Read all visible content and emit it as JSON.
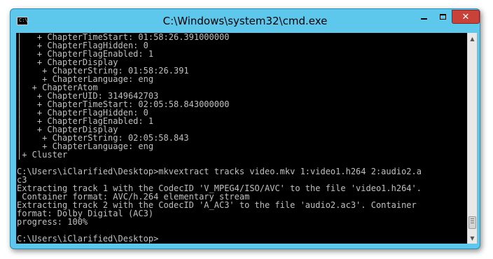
{
  "window": {
    "title": "C:\\Windows\\system32\\cmd.exe",
    "icon_label": "C:\\.",
    "icon": "console-app-icon"
  },
  "controls": {
    "minimize": "minimize-icon",
    "maximize": "maximize-icon",
    "close": "close-icon"
  },
  "console": {
    "lines": [
      "|   + ChapterTimeStart: 01:58:26.391000000",
      "|   + ChapterFlagHidden: 0",
      "|   + ChapterFlagEnabled: 1",
      "|   + ChapterDisplay",
      "|    + ChapterString: 01:58:26.391",
      "|    + ChapterLanguage: eng",
      "|  + ChapterAtom",
      "|   + ChapterUID: 3149642703",
      "|   + ChapterTimeStart: 02:05:58.843000000",
      "|   + ChapterFlagHidden: 0",
      "|   + ChapterFlagEnabled: 1",
      "|   + ChapterDisplay",
      "|    + ChapterString: 02:05:58.843",
      "|    + ChapterLanguage: eng",
      "|+ Cluster",
      "",
      "C:\\Users\\iClarified\\Desktop>mkvextract tracks video.mkv 1:video1.h264 2:audio2.a",
      "c3",
      "Extracting track 1 with the CodecID 'V_MPEG4/ISO/AVC' to the file 'video1.h264'.",
      " Container format: AVC/h.264 elementary stream",
      "Extracting track 2 with the CodecID 'A_AC3' to the file 'audio2.ac3'. Container",
      "format: Dolby Digital (AC3)",
      "progress: 100%",
      "",
      "C:\\Users\\iClarified\\Desktop>"
    ]
  },
  "colors": {
    "frame": "#5ec7ec",
    "console_bg": "#000000",
    "console_text": "#c0c0c0",
    "close_button": "#c8423a"
  }
}
